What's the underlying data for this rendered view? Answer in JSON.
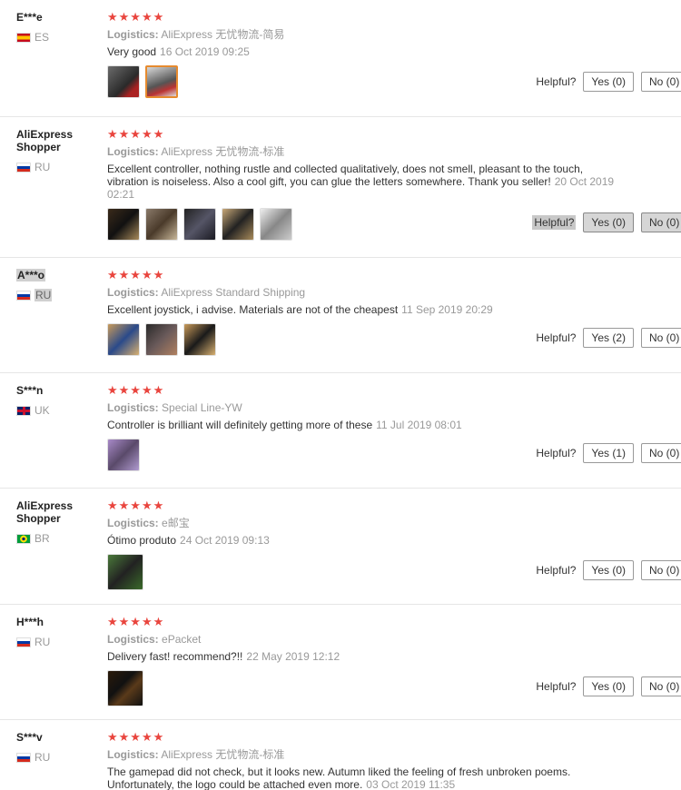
{
  "reviews": [
    {
      "user": "E***e",
      "country": "ES",
      "stars": "★★★★★",
      "logistics_label": "Logistics:",
      "logistics": "AliExpress 无忧物流-简易",
      "text": "Very good",
      "date": "16 Oct 2019 09:25",
      "helpful": "Helpful?",
      "yes": "Yes (0)",
      "no": "No (0)"
    },
    {
      "user": "AliExpress Shopper",
      "country": "RU",
      "stars": "★★★★★",
      "logistics_label": "Logistics:",
      "logistics": "AliExpress 无忧物流-标准",
      "text": "Excellent controller, nothing rustle and collected qualitatively, does not smell, pleasant to the touch, vibration is noiseless. Also a cool gift, you can glue the letters somewhere. Thank you seller!",
      "date": "20 Oct 2019 02:21",
      "helpful": "Helpful?",
      "yes": "Yes (0)",
      "no": "No (0)"
    },
    {
      "user": "A***o",
      "country": "RU",
      "stars": "★★★★★",
      "logistics_label": "Logistics:",
      "logistics": "AliExpress Standard Shipping",
      "text": "Excellent joystick, i advise. Materials are not of the cheapest",
      "date": "11 Sep 2019 20:29",
      "helpful": "Helpful?",
      "yes": "Yes (2)",
      "no": "No (0)"
    },
    {
      "user": "S***n",
      "country": "UK",
      "stars": "★★★★★",
      "logistics_label": "Logistics:",
      "logistics": "Special Line-YW",
      "text": "Controller is brilliant will definitely getting more of these",
      "date": "11 Jul 2019 08:01",
      "helpful": "Helpful?",
      "yes": "Yes (1)",
      "no": "No (0)"
    },
    {
      "user": "AliExpress Shopper",
      "country": "BR",
      "stars": "★★★★★",
      "logistics_label": "Logistics:",
      "logistics": "e邮宝",
      "text": "Ótimo produto",
      "date": "24 Oct 2019 09:13",
      "helpful": "Helpful?",
      "yes": "Yes (0)",
      "no": "No (0)"
    },
    {
      "user": "H***h",
      "country": "RU",
      "stars": "★★★★★",
      "logistics_label": "Logistics:",
      "logistics": "ePacket",
      "text": "Delivery fast! recommend?!!",
      "date": "22 May 2019 12:12",
      "helpful": "Helpful?",
      "yes": "Yes (0)",
      "no": "No (0)"
    },
    {
      "user": "S***v",
      "country": "RU",
      "stars": "★★★★★",
      "logistics_label": "Logistics:",
      "logistics": "AliExpress 无忧物流-标准",
      "text": "The gamepad did not check, but it looks new. Autumn liked the feeling of fresh unbroken poems. Unfortunately, the logo could be attached even more.",
      "date": "03 Oct 2019 11:35"
    }
  ],
  "colors": {
    "star": "#e9453e",
    "thumb_selected": "#e68a2e"
  }
}
